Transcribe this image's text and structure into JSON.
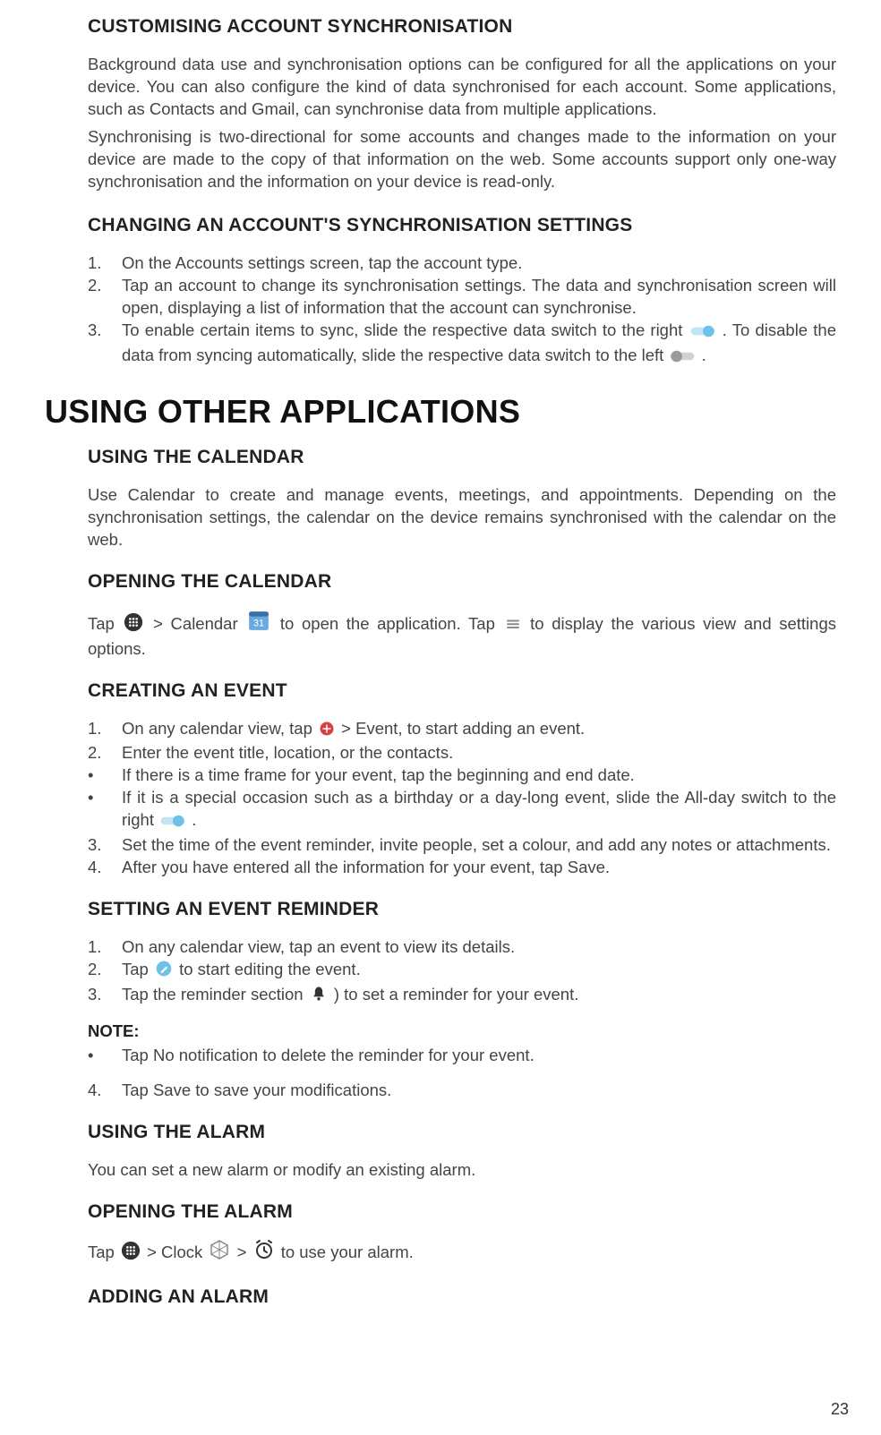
{
  "page_number": "23",
  "s1": {
    "h": "CUSTOMISING ACCOUNT SYNCHRONISATION",
    "p1": "Background data use and synchronisation options can be configured for all the applications on your device. You can also configure the kind of data synchronised for each account. Some applications, such as Contacts and Gmail, can synchronise data from multiple applications.",
    "p2": "Synchronising is two-directional for some accounts and changes made to the information on your device are made to the copy of that information on the web. Some accounts support only one-way synchronisation and the information on your device is read-only."
  },
  "s2": {
    "h": "CHANGING AN ACCOUNT'S SYNCHRONISATION SETTINGS",
    "i1": "On the Accounts settings screen, tap the account type.",
    "i2": "Tap an account to change its synchronisation settings. The data and synchronisation screen will open, displaying a list of information that the account can synchronise.",
    "i3a": "To enable certain items to sync, slide the respective data switch to the right ",
    "i3b": ". To disable the data from syncing automatically, slide the respective data switch to the left ",
    "i3c": "."
  },
  "h_main": "USING OTHER APPLICATIONS",
  "s3": {
    "h": "USING THE CALENDAR",
    "p": "Use Calendar to create and manage events, meetings, and appointments. Depending on the synchronisation settings, the calendar on the device remains synchronised with the calendar on the web."
  },
  "s4": {
    "h": "OPENING THE CALENDAR",
    "a": "Tap ",
    "b": " > Calendar ",
    "c": " to open the application. Tap ",
    "d": " to display the various view and settings options."
  },
  "s5": {
    "h": "CREATING AN EVENT",
    "i1a": "On any calendar view, tap ",
    "i1b": " > Event, to start adding an event.",
    "i2": "Enter the event title, location, or the contacts.",
    "b1": "If there is a time frame for your event, tap the beginning and end date.",
    "b2a": "If it is a special occasion such as a birthday or a day-long event, slide the All-day switch to the right ",
    "b2b": ".",
    "i3": "Set the time of the event reminder, invite people, set a colour, and add any notes or attachments.",
    "i4": "After you have entered all the information for your event, tap Save."
  },
  "s6": {
    "h": "SETTING AN EVENT REMINDER",
    "i1": "On any calendar view, tap an event to view its details.",
    "i2a": "Tap ",
    "i2b": " to start editing the event.",
    "i3a": "Tap the reminder section ",
    "i3b": " ) to set a reminder for your event."
  },
  "note": {
    "label": "NOTE:",
    "b": "Tap No notification to delete the reminder for your event.",
    "i4": "Tap Save to save your  modifications."
  },
  "s7": {
    "h": "USING THE ALARM",
    "p": "You can set a new alarm or modify an existing alarm."
  },
  "s8": {
    "h": "OPENING THE ALARM",
    "a": "Tap ",
    "b": " > Clock ",
    "c": " > ",
    "d": " to use your alarm."
  },
  "s9": {
    "h": "ADDING AN ALARM"
  }
}
